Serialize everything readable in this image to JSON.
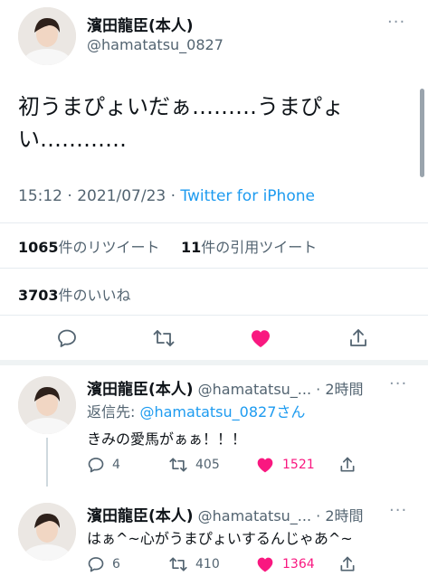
{
  "main_tweet": {
    "author_name": "濱田龍臣(本人)",
    "author_handle": "@hamatatsu_0827",
    "more": "···",
    "text_line1": "初うまぴょいだぁ………うまぴょ",
    "text_line2": "い…………",
    "time": "15:12",
    "sep": "·",
    "date": "2021/07/23",
    "source": "Twitter for iPhone",
    "retweets_count": "1065",
    "retweets_label": "件のリツイート",
    "quotes_count": "11",
    "quotes_label": "件の引用ツイート",
    "likes_count": "3703",
    "likes_label": "件のいいね"
  },
  "replies": [
    {
      "author_name": "濱田龍臣(本人)",
      "author_handle": "@hamatatsu_...",
      "time": "· 2時間",
      "more": "···",
      "reply_to_prefix": "返信先: ",
      "reply_to_handle": "@hamatatsu_0827さん",
      "text": "きみの愛馬がぁぁ！！！",
      "reply_count": "4",
      "retweet_count": "405",
      "like_count": "1521"
    },
    {
      "author_name": "濱田龍臣(本人)",
      "author_handle": "@hamatatsu_...",
      "time": "· 2時間",
      "more": "···",
      "text": "はぁ^~心がうまぴょいするんじゃあ^~",
      "reply_count": "6",
      "retweet_count": "410",
      "like_count": "1364"
    }
  ],
  "colors": {
    "accent": "#1d9bf0",
    "like": "#f91880",
    "muted": "#536471"
  }
}
